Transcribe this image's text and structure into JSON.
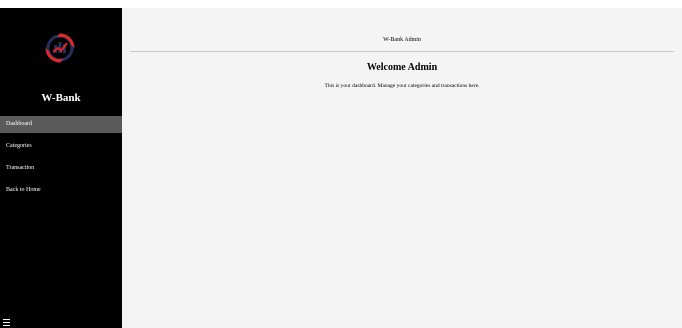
{
  "sidebar": {
    "logo_icon": "wbank-logo-icon",
    "brand": "W-Bank",
    "items": [
      {
        "label": "Dashboard",
        "active": true
      },
      {
        "label": "Categories",
        "active": false
      },
      {
        "label": "Transaction",
        "active": false
      },
      {
        "label": "Back to Home",
        "active": false
      }
    ],
    "menu_icon": "hamburger-menu-icon"
  },
  "header": {
    "title": "W-Bank Admin"
  },
  "main": {
    "heading": "Welcome Admin",
    "description": "This is your dashboard. Manage your categories and transactions here."
  },
  "colors": {
    "sidebar_bg": "#000000",
    "active_item_bg": "#5a5a5a",
    "main_bg": "#f4f4f4",
    "logo_red": "#e0282a",
    "logo_navy": "#22305c"
  }
}
